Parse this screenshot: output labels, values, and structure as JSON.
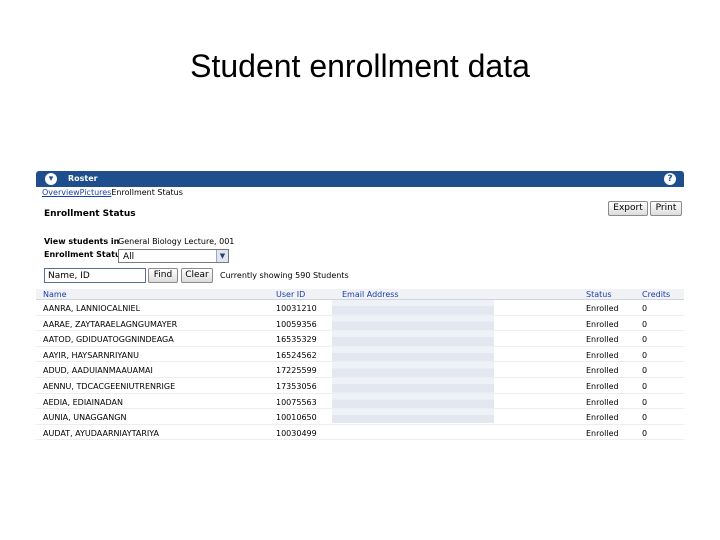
{
  "slide": {
    "title": "Student enrollment data"
  },
  "window": {
    "title": "Roster",
    "tabs": [
      {
        "label": "Overview",
        "active": false
      },
      {
        "label": "Pictures",
        "active": false
      },
      {
        "label": "Enrollment Status",
        "active": true
      }
    ],
    "section_title": "Enrollment Status",
    "export_label": "Export",
    "print_label": "Print"
  },
  "filters": {
    "view_label": "View students in",
    "view_value": "General Biology Lecture, 001",
    "status_label": "Enrollment Status",
    "status_value": "All",
    "search_value": "Name, ID",
    "find_label": "Find",
    "clear_label": "Clear",
    "showing_text": "Currently showing 590 Students"
  },
  "table": {
    "headers": {
      "name": "Name",
      "user_id": "User ID",
      "email": "Email Address",
      "status": "Status",
      "credits": "Credits"
    },
    "rows": [
      {
        "name": "AANRA, LANNIOCALNIEL",
        "user_id": "10031210",
        "email": "",
        "status": "Enrolled",
        "credits": "0"
      },
      {
        "name": "AARAE, ZAYTARAELAGNGUMAYER",
        "user_id": "10059356",
        "email": "",
        "status": "Enrolled",
        "credits": "0"
      },
      {
        "name": "AATOD, GDIDUATOGGNINDEAGA",
        "user_id": "16535329",
        "email": "",
        "status": "Enrolled",
        "credits": "0"
      },
      {
        "name": "AAYIR, HAYSARNRIYANU",
        "user_id": "16524562",
        "email": "",
        "status": "Enrolled",
        "credits": "0"
      },
      {
        "name": "ADUD, AADUIANMAAUAMAI",
        "user_id": "17225599",
        "email": "",
        "status": "Enrolled",
        "credits": "0"
      },
      {
        "name": "AENNU, TDCACGEENIUTRENRIGE",
        "user_id": "17353056",
        "email": "",
        "status": "Enrolled",
        "credits": "0"
      },
      {
        "name": "AEDIA, EDIAINADAN",
        "user_id": "10075563",
        "email": "",
        "status": "Enrolled",
        "credits": "0"
      },
      {
        "name": "AUNIA, UNAGGANGN",
        "user_id": "10010650",
        "email": "",
        "status": "Enrolled",
        "credits": "0"
      },
      {
        "name": "AUDAT, AYUDAARNIAYTARIYA",
        "user_id": "10030499",
        "email": "",
        "status": "Enrolled",
        "credits": "0"
      }
    ]
  },
  "colors": {
    "titlebar": "#1f4e8c",
    "link": "#1a3ea8"
  }
}
